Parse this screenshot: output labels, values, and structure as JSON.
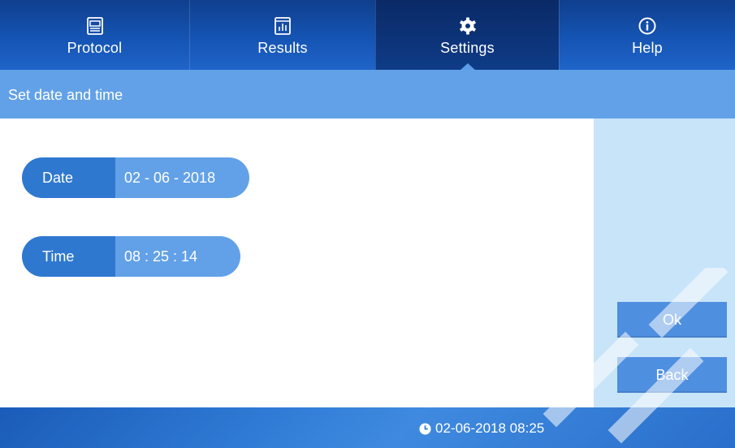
{
  "tabs": [
    {
      "label": "Protocol",
      "icon": "protocol-icon"
    },
    {
      "label": "Results",
      "icon": "results-chart-icon"
    },
    {
      "label": "Settings",
      "icon": "gear-icon"
    },
    {
      "label": "Help",
      "icon": "info-icon"
    }
  ],
  "active_tab": "Settings",
  "page": {
    "title": "Set date and time"
  },
  "date_field": {
    "label": "Date",
    "value": "02 - 06 - 2018"
  },
  "time_field": {
    "label": "Time",
    "value": "08 : 25 : 14"
  },
  "buttons": {
    "ok": "Ok",
    "back": "Back"
  },
  "status": {
    "datetime": "02-06-2018 08:25"
  },
  "colors": {
    "topbar": "#1554b3",
    "active_tab": "#0a2a66",
    "titlebar": "#62a1e7",
    "pill_label": "#2f78d0",
    "pill_value": "#62a1e7",
    "right_panel": "#c7e4f9",
    "button": "#4f8fe0"
  }
}
